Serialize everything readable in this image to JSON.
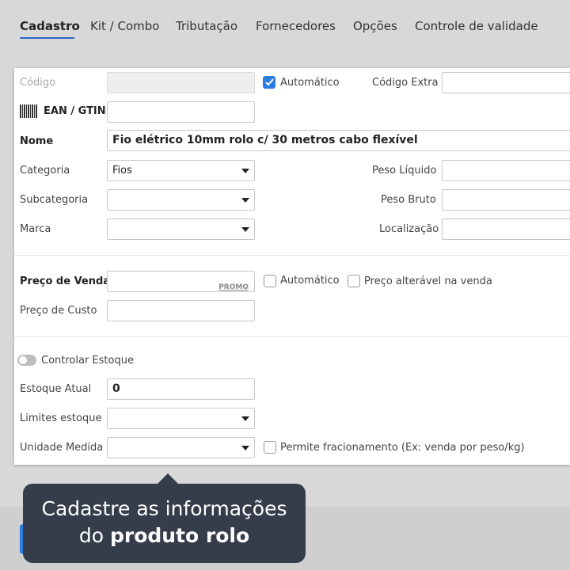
{
  "tabs": [
    {
      "label": "Cadastro",
      "active": true
    },
    {
      "label": "Kit / Combo"
    },
    {
      "label": "Tributação"
    },
    {
      "label": "Fornecedores"
    },
    {
      "label": "Opções"
    },
    {
      "label": "Controle de validade"
    }
  ],
  "form": {
    "codigo_label": "Código",
    "codigo_value": "",
    "automatico_label": "Automático",
    "automatico_checked": true,
    "codigo_extra_label": "Código Extra",
    "ean_label": "EAN / GTIN",
    "nome_label": "Nome",
    "nome_value": "Fio elétrico 10mm rolo c/ 30 metros cabo flexível",
    "categoria_label": "Categoria",
    "categoria_value": "Fios",
    "subcategoria_label": "Subcategoria",
    "marca_label": "Marca",
    "peso_liquido_label": "Peso Líquido",
    "peso_bruto_label": "Peso Bruto",
    "localizacao_label": "Localização",
    "preco_venda_label": "Preço de Venda",
    "promo_label": "PROMO",
    "preco_automatico_label": "Automático",
    "preco_alteravel_label": "Preço alterável na venda",
    "preco_custo_label": "Preço de Custo",
    "controlar_estoque_label": "Controlar Estoque",
    "estoque_atual_label": "Estoque Atual",
    "estoque_atual_value": "0",
    "limites_estoque_label": "Limites estoque",
    "unidade_medida_label": "Unidade Medida",
    "permite_fracionamento_label": "Permite fracionamento (Ex: venda por peso/kg)"
  },
  "tooltip": {
    "line1": "Cadastre as informações",
    "line2_prefix": "do ",
    "line2_bold": "produto rolo"
  },
  "colors": {
    "accent": "#2a7ee0",
    "tooltip_bg": "#353d4b"
  },
  "icons": {
    "barcode": "barcode-icon",
    "checkmark": "check-icon",
    "dropdown": "chevron-down-icon"
  }
}
